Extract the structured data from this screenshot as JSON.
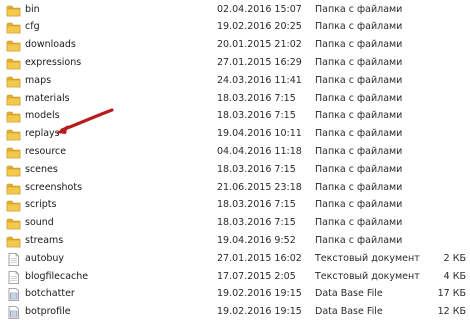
{
  "files": [
    {
      "name": "bin",
      "date": "02.04.2016 15:07",
      "type": "Папка с файлами",
      "size": "",
      "icon": "folder-icon"
    },
    {
      "name": "cfg",
      "date": "19.02.2016 20:25",
      "type": "Папка с файлами",
      "size": "",
      "icon": "folder-icon"
    },
    {
      "name": "downloads",
      "date": "20.01.2015 21:02",
      "type": "Папка с файлами",
      "size": "",
      "icon": "folder-icon"
    },
    {
      "name": "expressions",
      "date": "27.01.2015 16:29",
      "type": "Папка с файлами",
      "size": "",
      "icon": "folder-icon"
    },
    {
      "name": "maps",
      "date": "24.03.2016 11:41",
      "type": "Папка с файлами",
      "size": "",
      "icon": "folder-icon"
    },
    {
      "name": "materials",
      "date": "18.03.2016 7:15",
      "type": "Папка с файлами",
      "size": "",
      "icon": "folder-icon"
    },
    {
      "name": "models",
      "date": "18.03.2016 7:15",
      "type": "Папка с файлами",
      "size": "",
      "icon": "folder-icon"
    },
    {
      "name": "replays",
      "date": "19.04.2016 10:11",
      "type": "Папка с файлами",
      "size": "",
      "icon": "folder-icon"
    },
    {
      "name": "resource",
      "date": "04.04.2016 11:18",
      "type": "Папка с файлами",
      "size": "",
      "icon": "folder-icon"
    },
    {
      "name": "scenes",
      "date": "18.03.2016 7:15",
      "type": "Папка с файлами",
      "size": "",
      "icon": "folder-icon"
    },
    {
      "name": "screenshots",
      "date": "21.06.2015 23:18",
      "type": "Папка с файлами",
      "size": "",
      "icon": "folder-icon"
    },
    {
      "name": "scripts",
      "date": "18.03.2016 7:15",
      "type": "Папка с файлами",
      "size": "",
      "icon": "folder-icon"
    },
    {
      "name": "sound",
      "date": "18.03.2016 7:15",
      "type": "Папка с файлами",
      "size": "",
      "icon": "folder-icon"
    },
    {
      "name": "streams",
      "date": "19.04.2016 9:52",
      "type": "Папка с файлами",
      "size": "",
      "icon": "folder-icon"
    },
    {
      "name": "autobuy",
      "date": "27.01.2015 16:02",
      "type": "Текстовый документ",
      "size": "2 КБ",
      "icon": "text-document-icon"
    },
    {
      "name": "blogfilecache",
      "date": "17.07.2015 2:05",
      "type": "Текстовый документ",
      "size": "4 КБ",
      "icon": "text-document-icon"
    },
    {
      "name": "botchatter",
      "date": "19.02.2016 19:15",
      "type": "Data Base File",
      "size": "17 КБ",
      "icon": "database-file-icon"
    },
    {
      "name": "botprofile",
      "date": "19.02.2016 19:15",
      "type": "Data Base File",
      "size": "12 КБ",
      "icon": "database-file-icon"
    }
  ],
  "annotation": {
    "icon": "red-arrow-icon",
    "points_to": "replays",
    "color": "#b71c1c"
  },
  "colors": {
    "folder_body": "#f3c94c",
    "folder_tab": "#e2ad2f",
    "folder_edge": "#c89423",
    "document_border": "#8a8a8a"
  }
}
